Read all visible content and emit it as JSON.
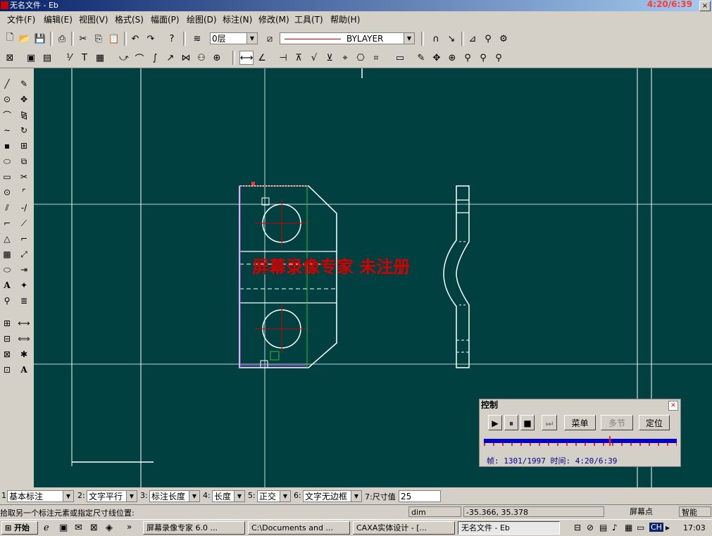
{
  "window": {
    "title": "无名文件 - Eb",
    "clock": "4:20/6:39",
    "close_symbol": "×"
  },
  "menu": [
    "文件(F)",
    "编辑(E)",
    "视图(V)",
    "格式(S)",
    "幅面(P)",
    "绘图(D)",
    "标注(N)",
    "修改(M)",
    "工具(T)",
    "帮助(H)"
  ],
  "toolbar": {
    "layer": "0层",
    "linetype": "BYLAYER"
  },
  "watermark": "屏幕录像专家  未注册",
  "control_panel": {
    "title": "控制",
    "buttons": {
      "play": "▶",
      "pause": "⏸",
      "stop": "■",
      "step": "⏭",
      "menu": "菜单",
      "multi": "多节",
      "locate": "定位"
    },
    "status": "帧: 1301/1997 时间: 4:20/6:39",
    "progress": 0.651
  },
  "dim_bar": {
    "f1_label": "1:",
    "f1": "基本标注",
    "f2_label": "2:",
    "f2": "文字平行",
    "f3_label": "3:",
    "f3": "标注长度",
    "f4_label": "4:",
    "f4": "长度",
    "f5_label": "5:",
    "f5": "正交",
    "f6_label": "6:",
    "f6": "文字无边框",
    "f7_label": "7:尺寸值",
    "f7": "25"
  },
  "status": {
    "prompt": "拾取另一个标注元素或指定尺寸线位置:",
    "command": "dim",
    "coords": "-35.366, 35.378",
    "snap": "屏幕点",
    "smart": "智能"
  },
  "taskbar": {
    "start": "开始",
    "chevron": "»",
    "tasks": [
      "屏幕录像专家 6.0 ...",
      "C:\\Documents and ...",
      "CAXA实体设计 - [...",
      "无名文件 - Eb"
    ],
    "tray_lang": "CH",
    "clock": "17:03"
  },
  "colors": {
    "canvas": "#004040",
    "accent": "#0a246a",
    "watermark": "#d40000"
  }
}
